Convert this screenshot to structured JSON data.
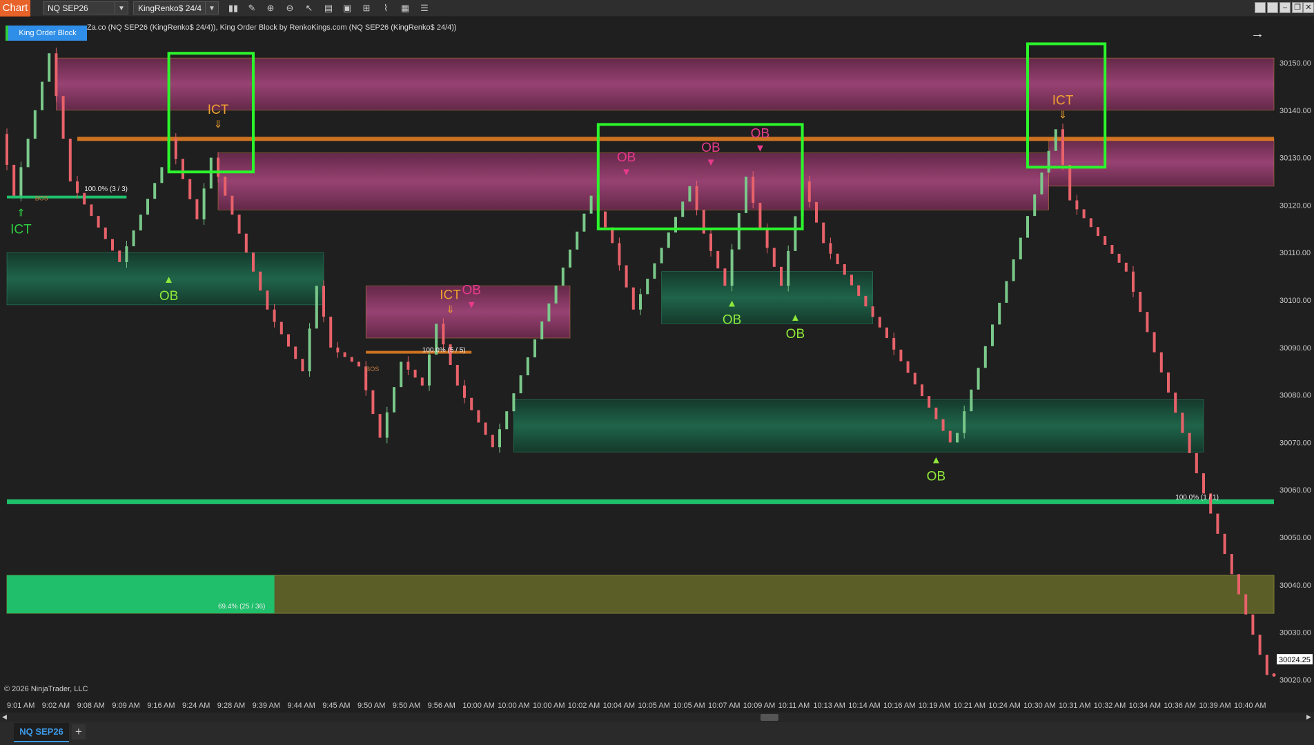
{
  "toolbar": {
    "chart_label": "Chart",
    "instrument": "NQ SEP26",
    "bar_type": "KingRenko$ 24/4",
    "icons": [
      "bar-chart-icon",
      "pencil-icon",
      "zoom-in-icon",
      "zoom-out-icon",
      "pointer-icon",
      "data-box-icon",
      "properties-icon",
      "templates-icon",
      "strategies-icon",
      "indicators-icon",
      "list-icon"
    ]
  },
  "indicator": {
    "button_label": "King Order Block",
    "title": "Za.co (NQ SEP26 (KingRenko$ 24/4)), King Order Block by RenkoKings.com (NQ SEP26 (KingRenko$ 24/4))"
  },
  "footer": {
    "copyright": "© 2026 NinjaTrader, LLC",
    "tab_label": "NQ SEP26",
    "add_tab": "+"
  },
  "colors": {
    "bull": "#7ac98a",
    "bear": "#e8626a",
    "supply": "#a2457a",
    "demand": "#1f6b4e",
    "ict": "#f0a030",
    "ob_bull": "#8fe83a",
    "ob_bear": "#e83a8c",
    "highlight": "#2cf52c"
  },
  "chart_data": {
    "type": "renko",
    "price_axis": [
      30150,
      30140,
      30130,
      30120,
      30110,
      30100,
      30090,
      30080,
      30070,
      30060,
      30050,
      30040,
      30030,
      30020
    ],
    "time_axis": [
      "9:01 AM",
      "9:02 AM",
      "9:08 AM",
      "9:09 AM",
      "9:16 AM",
      "9:24 AM",
      "9:28 AM",
      "9:39 AM",
      "9:44 AM",
      "9:45 AM",
      "9:50 AM",
      "9:50 AM",
      "9:56 AM",
      "10:00 AM",
      "10:00 AM",
      "10:00 AM",
      "10:02 AM",
      "10:04 AM",
      "10:05 AM",
      "10:05 AM",
      "10:07 AM",
      "10:09 AM",
      "10:11 AM",
      "10:13 AM",
      "10:14 AM",
      "10:16 AM",
      "10:19 AM",
      "10:21 AM",
      "10:24 AM",
      "10:30 AM",
      "10:31 AM",
      "10:32 AM",
      "10:34 AM",
      "10:36 AM",
      "10:39 AM",
      "10:40 AM"
    ],
    "last_price": "30024.25",
    "ylim": [
      30017,
      30157
    ],
    "path": [
      [
        0,
        30135
      ],
      [
        2,
        30122
      ],
      [
        7,
        30152
      ],
      [
        10,
        30125
      ],
      [
        17,
        30108
      ],
      [
        23,
        30128
      ],
      [
        24,
        30134
      ],
      [
        28,
        30117
      ],
      [
        30,
        30130
      ],
      [
        38,
        30098
      ],
      [
        43,
        30085
      ],
      [
        45,
        30103
      ],
      [
        47,
        30090
      ],
      [
        51,
        30086
      ],
      [
        54,
        30071
      ],
      [
        57,
        30087
      ],
      [
        60,
        30082
      ],
      [
        62,
        30095
      ],
      [
        65,
        30082
      ],
      [
        70,
        30069
      ],
      [
        84,
        30122
      ],
      [
        87,
        30112
      ],
      [
        90,
        30098
      ],
      [
        98,
        30124
      ],
      [
        100,
        30114
      ],
      [
        103,
        30103
      ],
      [
        106,
        30126
      ],
      [
        108,
        30115
      ],
      [
        111,
        30103
      ],
      [
        114,
        30125
      ],
      [
        117,
        30112
      ],
      [
        126,
        30092
      ],
      [
        135,
        30070
      ],
      [
        136,
        30072
      ],
      [
        150,
        30136
      ],
      [
        152,
        30121
      ],
      [
        160,
        30106
      ],
      [
        180,
        30021
      ]
    ],
    "zones": [
      {
        "kind": "supply",
        "from": 30151,
        "to": 30140,
        "x0": 7,
        "x1": 180
      },
      {
        "kind": "supply",
        "from": 30131,
        "to": 30119,
        "x0": 30,
        "x1": 148
      },
      {
        "kind": "supply",
        "from": 30134,
        "to": 30124,
        "x0": 148,
        "x1": 184
      },
      {
        "kind": "supply",
        "from": 30103,
        "to": 30092,
        "x0": 51,
        "x1": 80
      },
      {
        "kind": "demand",
        "from": 30110,
        "to": 30099,
        "x0": 0,
        "x1": 45
      },
      {
        "kind": "demand",
        "from": 30106,
        "to": 30095,
        "x0": 93,
        "x1": 123
      },
      {
        "kind": "demand",
        "from": 30079,
        "to": 30068,
        "x0": 72,
        "x1": 170
      },
      {
        "kind": "demand",
        "from": 30058,
        "to": 30057,
        "x0": 0,
        "x1": 184
      },
      {
        "kind": "partial",
        "from": 30042,
        "to": 30034,
        "x0": 0,
        "x1": 180,
        "filled": 38
      }
    ],
    "signals": [
      {
        "text": "ICT",
        "kind": "ict-bull",
        "x": 2,
        "price": 30122
      },
      {
        "text": "OB",
        "kind": "ob-bull",
        "x": 23,
        "price": 30108
      },
      {
        "text": "ICT",
        "kind": "ict-bear",
        "x": 30,
        "price": 30134
      },
      {
        "text": "ICT",
        "kind": "ict-bear",
        "x": 63,
        "price": 30095
      },
      {
        "text": "OB",
        "kind": "ob-bear",
        "x": 66,
        "price": 30096
      },
      {
        "text": "OB",
        "kind": "ob-bear",
        "x": 88,
        "price": 30124
      },
      {
        "text": "OB",
        "kind": "ob-bear",
        "x": 100,
        "price": 30126
      },
      {
        "text": "OB",
        "kind": "ob-bear",
        "x": 107,
        "price": 30129
      },
      {
        "text": "OB",
        "kind": "ob-bull",
        "x": 103,
        "price": 30103
      },
      {
        "text": "OB",
        "kind": "ob-bull",
        "x": 112,
        "price": 30100
      },
      {
        "text": "OB",
        "kind": "ob-bull",
        "x": 132,
        "price": 30070
      },
      {
        "text": "ICT",
        "kind": "ict-bear",
        "x": 150,
        "price": 30136
      }
    ],
    "labels": [
      {
        "text": "100.0% (3 / 3)",
        "x": 11,
        "price": 30123
      },
      {
        "text": "BOS",
        "x": 4,
        "price": 30121
      },
      {
        "text": "100.0% (5 / 5)",
        "x": 59,
        "price": 30089
      },
      {
        "text": "BOS",
        "x": 51,
        "price": 30085
      },
      {
        "text": "100.0% (1 / 1)",
        "x": 166,
        "price": 30058
      },
      {
        "text": "69.4% (25 / 36)",
        "x": 30,
        "price": 30035
      }
    ],
    "highlights": [
      {
        "x0": 23,
        "x1": 35,
        "p0": 30152,
        "p1": 30127
      },
      {
        "x0": 84,
        "x1": 113,
        "p0": 30137,
        "p1": 30115
      },
      {
        "x0": 145,
        "x1": 156,
        "p0": 30154,
        "p1": 30128
      }
    ]
  }
}
